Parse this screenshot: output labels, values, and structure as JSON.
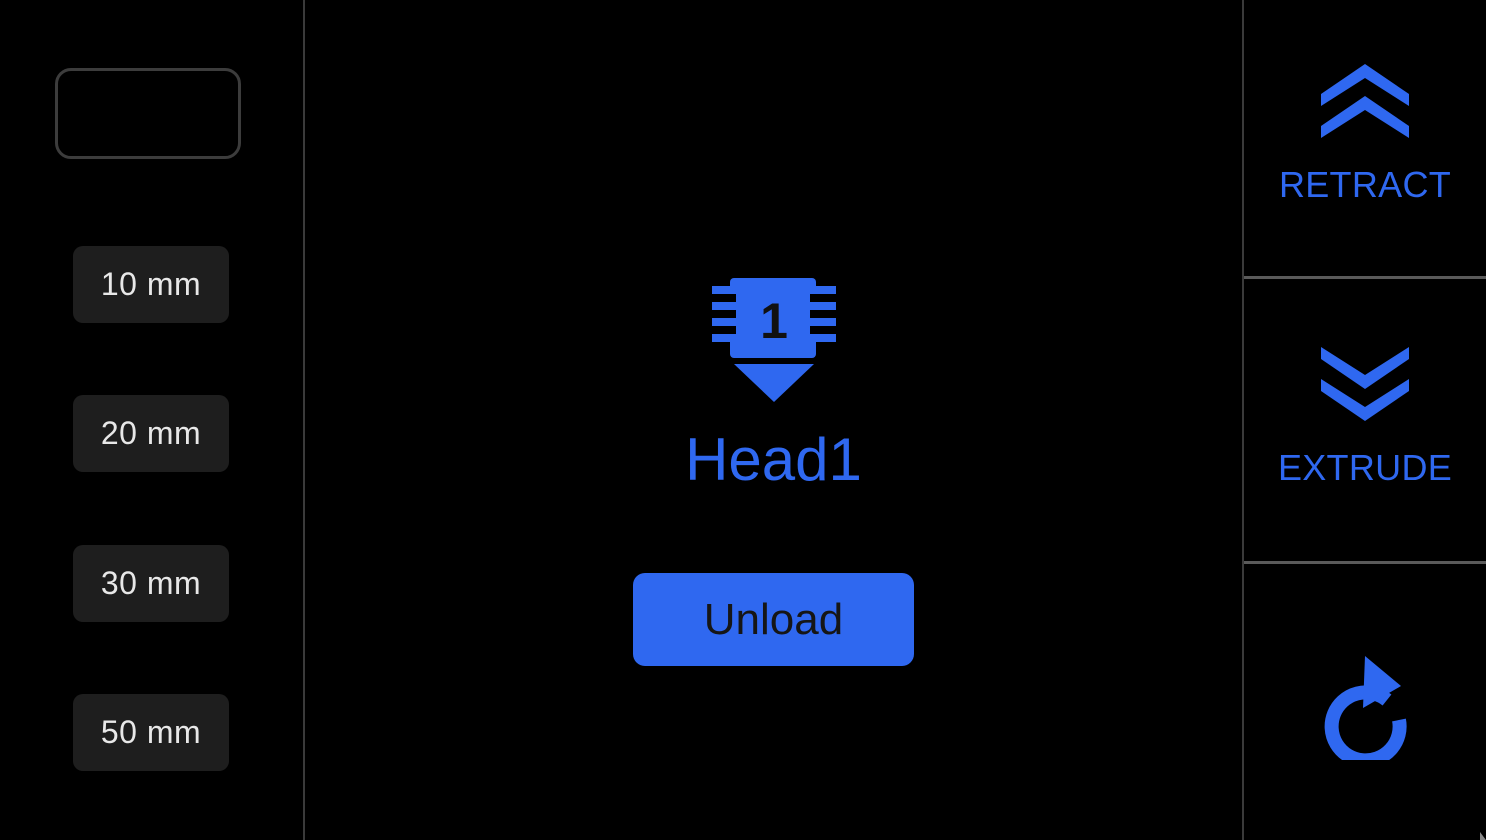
{
  "left_panel": {
    "step_options": [
      {
        "label": "10 mm"
      },
      {
        "label": "20 mm"
      },
      {
        "label": "30 mm"
      },
      {
        "label": "50 mm"
      }
    ]
  },
  "center": {
    "head_number": "1",
    "head_label": "Head1",
    "unload_label": "Unload"
  },
  "right_panel": {
    "retract_label": "RETRACT",
    "extrude_label": "EXTRUDE",
    "retract_icon": "double-chevron-up-icon",
    "extrude_icon": "double-chevron-down-icon",
    "refresh_icon": "refresh-icon"
  },
  "colors": {
    "accent": "#2f68f0",
    "background": "#000000",
    "button_bg": "#1e1e1e",
    "divider": "#5a5a5a"
  }
}
